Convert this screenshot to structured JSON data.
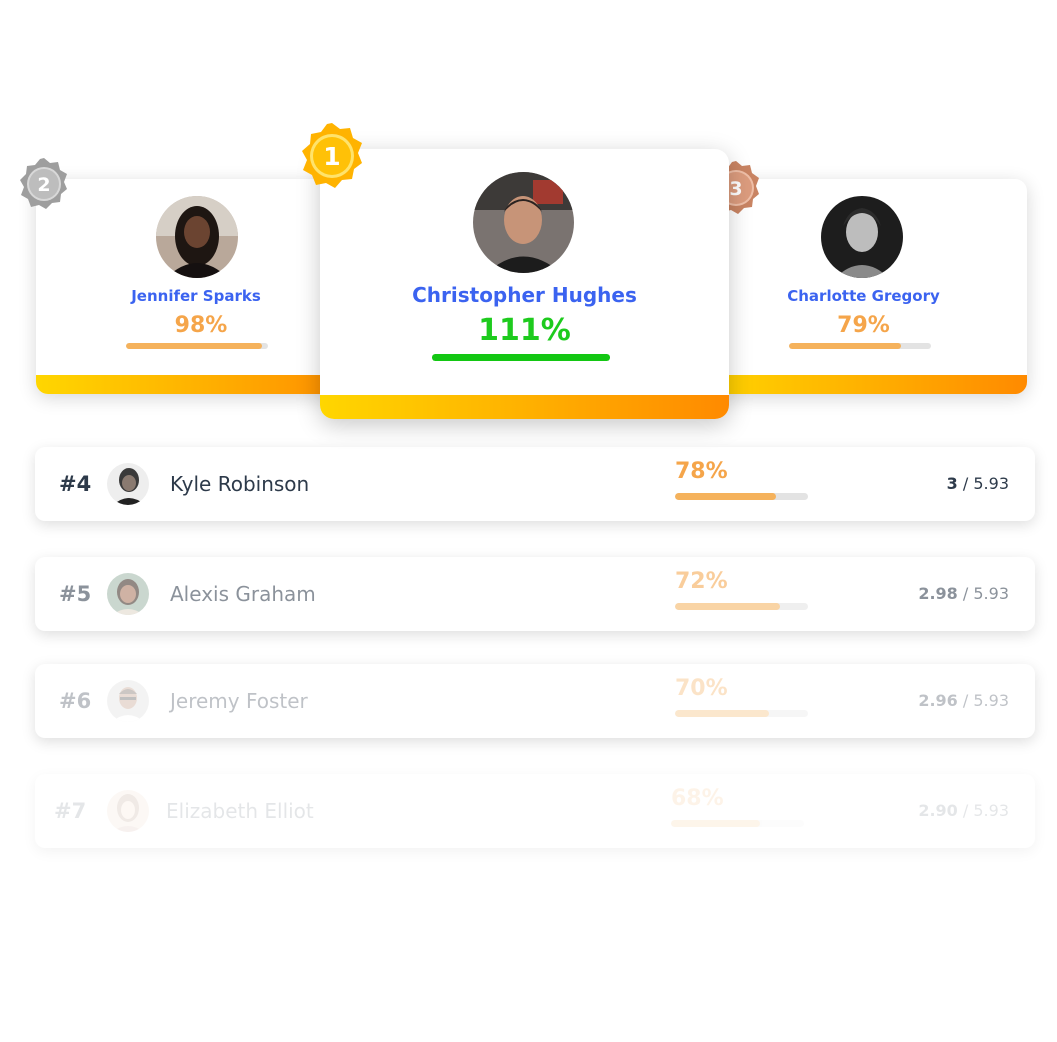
{
  "podium": {
    "first": {
      "rank": "1",
      "name": "Christopher Hughes",
      "percent": "111%",
      "progress": 1.0
    },
    "second": {
      "rank": "2",
      "name": "Jennifer Sparks",
      "percent": "98%",
      "progress": 0.96
    },
    "third": {
      "rank": "3",
      "name": "Charlotte Gregory",
      "percent": "79%",
      "progress": 0.79
    }
  },
  "rows": [
    {
      "rank": "#4",
      "name": "Kyle Robinson",
      "percent": "78%",
      "progress": 0.76,
      "score": "3",
      "total": "/ 5.93",
      "opacity": 1.0
    },
    {
      "rank": "#5",
      "name": "Alexis Graham",
      "percent": "72%",
      "progress": 0.79,
      "score": "2.98",
      "total": "/ 5.93",
      "opacity": 0.55
    },
    {
      "rank": "#6",
      "name": "Jeremy Foster",
      "percent": "70%",
      "progress": 0.71,
      "score": "2.96",
      "total": "/ 5.93",
      "opacity": 0.3
    },
    {
      "rank": "#7",
      "name": "Elizabeth Elliot",
      "percent": "68%",
      "progress": 0.67,
      "score": "2.90",
      "total": "/ 5.93",
      "opacity": 0.12
    }
  ],
  "colors": {
    "name_blue": "#3b63f0",
    "first_percent_green": "#1ecb1e",
    "percent_orange": "#f5a54a",
    "gold": "#ffb300",
    "silver": "#a0a0a0",
    "bronze": "#d08a6a"
  }
}
